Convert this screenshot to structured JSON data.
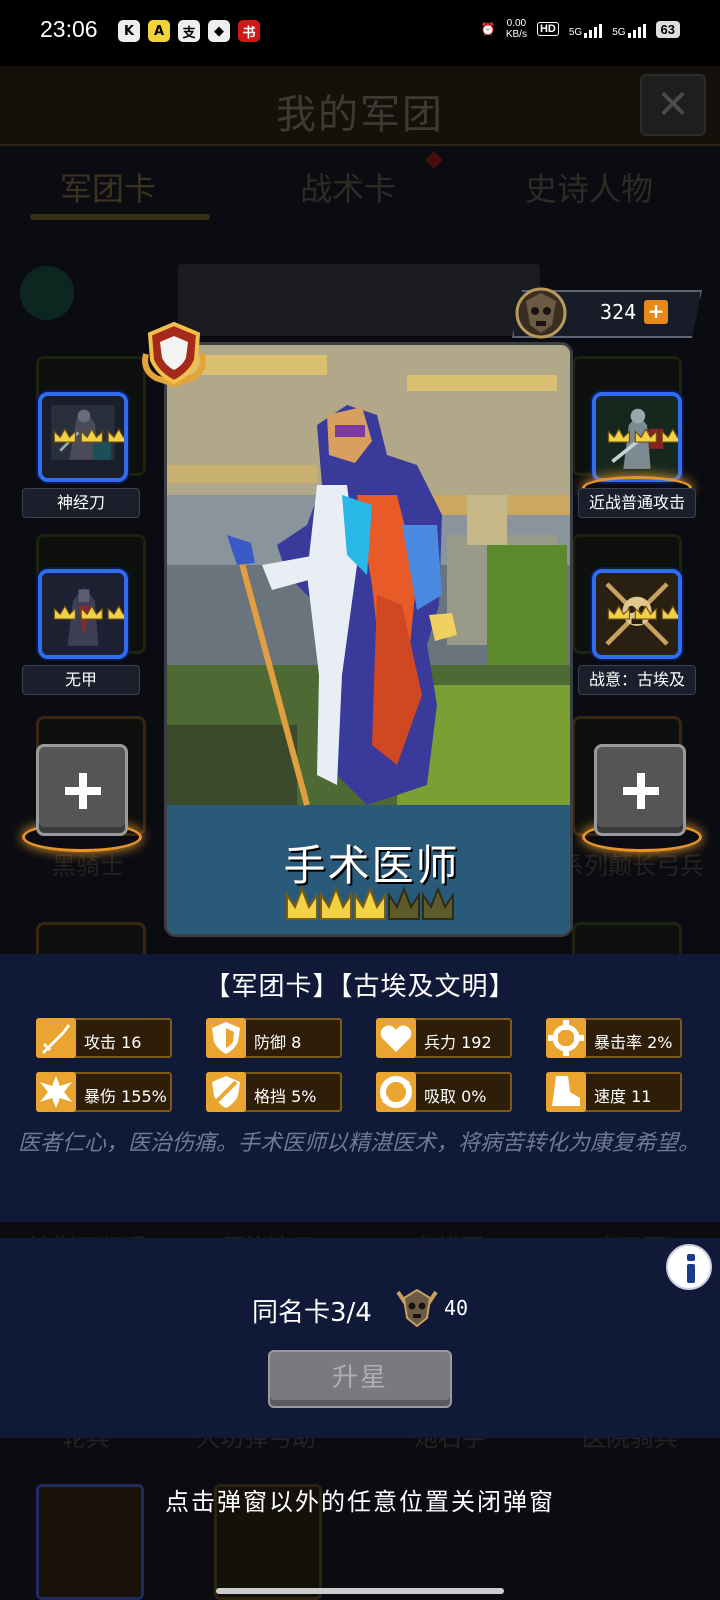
{
  "status_bar": {
    "time": "23:06",
    "apps": [
      "K",
      "A",
      "支",
      "◆",
      "书"
    ],
    "net_speed": "0.00",
    "net_unit": "KB/s",
    "hd": "HD",
    "sig1": "5G",
    "sig2": "5G",
    "battery": "63"
  },
  "background": {
    "title": "我的军团",
    "tabs": [
      "军团卡",
      "战术卡",
      "史诗人物"
    ],
    "labels": [
      "黑骑士",
      "系列颠长弓兵",
      "披荆再佣兵",
      "便旅浪子",
      "高龍军",
      "皮卫军",
      "轮兵",
      "大坊弹弓助",
      "炮石手",
      "医院骑兵"
    ]
  },
  "currency": {
    "value": "324"
  },
  "left_cards": [
    {
      "label": "神经刀",
      "crowns": 3
    },
    {
      "label": "无甲",
      "crowns": 3
    }
  ],
  "right_cards": [
    {
      "label": "近战普通攻击",
      "crowns": 3
    },
    {
      "label": "战意：古埃及",
      "crowns": 3
    }
  ],
  "card": {
    "name": "手术医师",
    "stars_filled": 3,
    "stars_total": 5,
    "category": "【军团卡】【古埃及文明】",
    "stats": [
      {
        "icon": "sword-icon",
        "text": "攻击 16"
      },
      {
        "icon": "shield-icon",
        "text": "防御 8"
      },
      {
        "icon": "heart-icon",
        "text": "兵力 192"
      },
      {
        "icon": "crosshair-icon",
        "text": "暴击率 2%"
      },
      {
        "icon": "burst-icon",
        "text": "暴伤 155%"
      },
      {
        "icon": "block-icon",
        "text": "格挡 5%"
      },
      {
        "icon": "drain-icon",
        "text": "吸取 0%"
      },
      {
        "icon": "boot-icon",
        "text": "速度 11"
      }
    ],
    "description": "医者仁心，医治伤痛。手术医师以精湛医术，将病苦转化为康复希望。"
  },
  "upgrade": {
    "duplicate_label": "同名卡3/4",
    "cost": "40",
    "button": "升星"
  },
  "hint": "点击弹窗以外的任意位置关闭弹窗",
  "colors": {
    "accent_gold": "#e9a52f",
    "panel_blue": "#121a3a",
    "card_border_blue": "#2f6cf0"
  }
}
